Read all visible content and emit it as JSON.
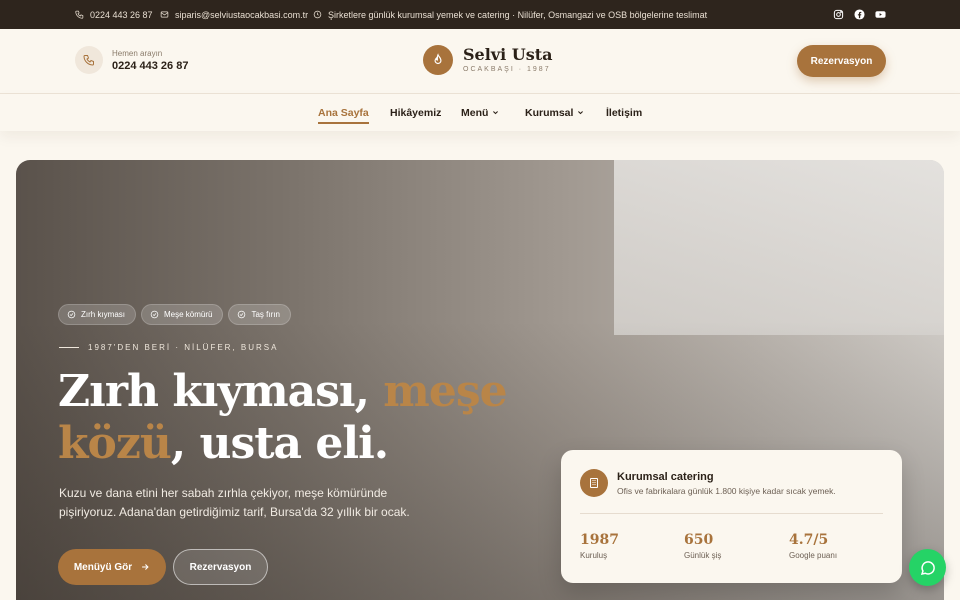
{
  "topbar": {
    "phone": "0224 443 26 87",
    "email": "siparis@selviustaocakbasi.com.tr",
    "notice": "Şirketlere günlük kurumsal yemek ve catering · Nilüfer, Osmangazi ve OSB bölgelerine teslimat",
    "socials": [
      "instagram-icon",
      "facebook-icon",
      "youtube-icon"
    ]
  },
  "header": {
    "call_label": "Hemen arayın",
    "call_number": "0224 443 26 87",
    "brand_name": "Selvi Usta",
    "brand_sub": "OCAKBAŞI · 1987",
    "reservation": "Rezervasyon"
  },
  "nav": {
    "items": [
      {
        "label": "Ana Sayfa",
        "active": true
      },
      {
        "label": "Hikâyemiz"
      },
      {
        "label": "Menü",
        "dropdown": true
      },
      {
        "label": "Kurumsal",
        "dropdown": true
      },
      {
        "label": "İletişim"
      }
    ]
  },
  "hero": {
    "chips": [
      "Zırh kıyması",
      "Meşe kömürü",
      "Taş fırın"
    ],
    "eyebrow": "1987'DEN BERİ · NİLÜFER, BURSA",
    "headline_1a": "Zırh kıyması, ",
    "headline_1b": "meşe",
    "headline_2a": "közü",
    "headline_2b": ", usta eli.",
    "description": "Kuzu ve dana etini her sabah zırhla çekiyor, meşe kömüründe pişiriyoruz. Adana'dan getirdiğimiz tarif, Bursa'da 32 yıllık bir ocak.",
    "btn_menu": "Menüyü Gör",
    "btn_reservation": "Rezervasyon"
  },
  "card": {
    "title": "Kurumsal catering",
    "subtitle": "Ofis ve fabrikalara günlük 1.800 kişiye kadar sıcak yemek.",
    "stats": [
      {
        "value": "1987",
        "label": "Kuruluş"
      },
      {
        "value": "650",
        "label": "Günlük şiş"
      },
      {
        "value": "4.7/5",
        "label": "Google puanı"
      }
    ]
  },
  "colors": {
    "accent": "#a8733c",
    "topbar": "#2e251d",
    "background": "#fbf7ef",
    "whatsapp": "#25d366"
  }
}
